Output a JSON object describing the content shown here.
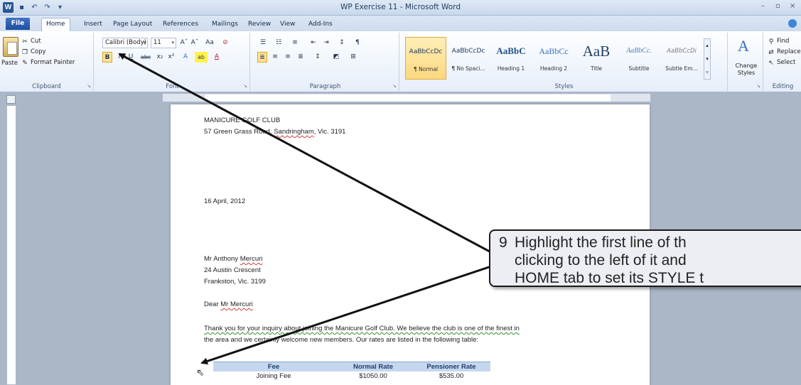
{
  "window": {
    "title": "WP Exercise 11 - Microsoft Word",
    "app_icon": "W"
  },
  "tabs": [
    "File",
    "Home",
    "Insert",
    "Page Layout",
    "References",
    "Mailings",
    "Review",
    "View",
    "Add-Ins"
  ],
  "ribbon": {
    "clipboard": {
      "label": "Clipboard",
      "paste": "Paste",
      "cut": "Cut",
      "copy": "Copy",
      "format_painter": "Format Painter"
    },
    "font": {
      "label": "Font",
      "font_name": "Calibri (Body)",
      "font_size": "11",
      "grow": "Aˆ",
      "shrink": "Aˇ",
      "change_case": "Aa",
      "clear": "⊘",
      "bold": "B",
      "italic": "I",
      "underline": "U",
      "strike": "abc",
      "subscript": "x₂",
      "superscript": "x²",
      "effects": "A",
      "highlight": "ab",
      "color": "A"
    },
    "paragraph": {
      "label": "Paragraph",
      "sort": "↕",
      "show": "¶"
    },
    "styles": {
      "label": "Styles",
      "items": [
        {
          "sample": "AaBbCcDc",
          "name": "¶ Normal"
        },
        {
          "sample": "AaBbCcDc",
          "name": "¶ No Spaci..."
        },
        {
          "sample": "AaBbC",
          "name": "Heading 1"
        },
        {
          "sample": "AaBbCc",
          "name": "Heading 2"
        },
        {
          "sample": "AaB",
          "name": "Title"
        },
        {
          "sample": "AaBbCc.",
          "name": "Subtitle"
        },
        {
          "sample": "AaBbCcDi",
          "name": "Subtle Em..."
        }
      ],
      "change_styles": "Change Styles"
    },
    "editing": {
      "label": "Editing",
      "find": "Find",
      "replace": "Replace",
      "select": "Select"
    }
  },
  "document": {
    "line1": "MANICURE GOLF CLUB",
    "line2_prefix": "57 Green Grass Road, ",
    "line2_town": "Sandringham",
    "line2_suffix": ", Vic. 3191",
    "date": "16 April, 2012",
    "addr1_prefix": "Mr Anthony ",
    "addr1_name": "Mercuri",
    "addr2": "24 Austin Crescent",
    "addr3": "Frankston, Vic. 3199",
    "salutation_prefix": "Dear ",
    "salutation_name": "Mr Mercuri",
    "body1": "Thank you for your inquiry about joining the Manicure Golf Club.  We believe the club is one of the finest in",
    "body2": "the area and we certainly welcome new members. Our rates are listed in the following table:",
    "table": {
      "headers": [
        "Fee",
        "Normal Rate",
        "Pensioner Rate"
      ],
      "rows": [
        [
          "Joining Fee",
          "$1050.00",
          "$535.00"
        ]
      ]
    }
  },
  "callout": {
    "number": "9",
    "line1": "Highlight the first line of th",
    "line2": "clicking to the left of it and",
    "line3": "HOME tab to set its STYLE t"
  }
}
